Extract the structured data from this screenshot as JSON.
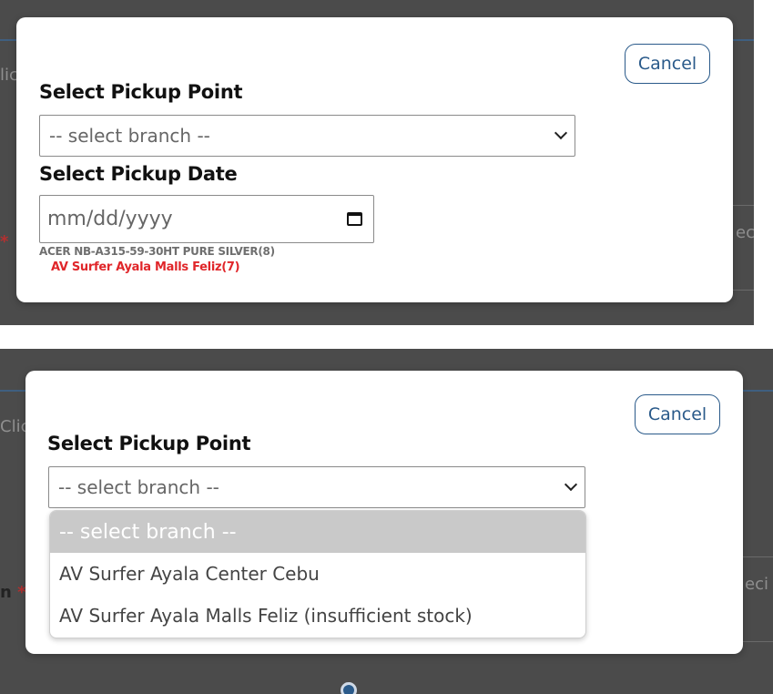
{
  "top_panel": {
    "cancel_label": "Cancel",
    "pickup_point_label": "Select Pickup Point",
    "branch_select_value": "-- select branch --",
    "pickup_date_label": "Select Pickup Date",
    "date_placeholder": "mm/dd/yyyy",
    "product_line": "ACER NB-A315-59-30HT PURE SILVER(8)",
    "stock_line": "AV Surfer Ayala Malls Feliz(7)"
  },
  "bottom_panel": {
    "cancel_label": "Cancel",
    "pickup_point_label": "Select Pickup Point",
    "branch_select_value": "-- select branch --",
    "dropdown_options": [
      "-- select branch --",
      "AV Surfer Ayala Center Cebu",
      "AV Surfer Ayala Malls Feliz (insufficient stock)"
    ]
  }
}
